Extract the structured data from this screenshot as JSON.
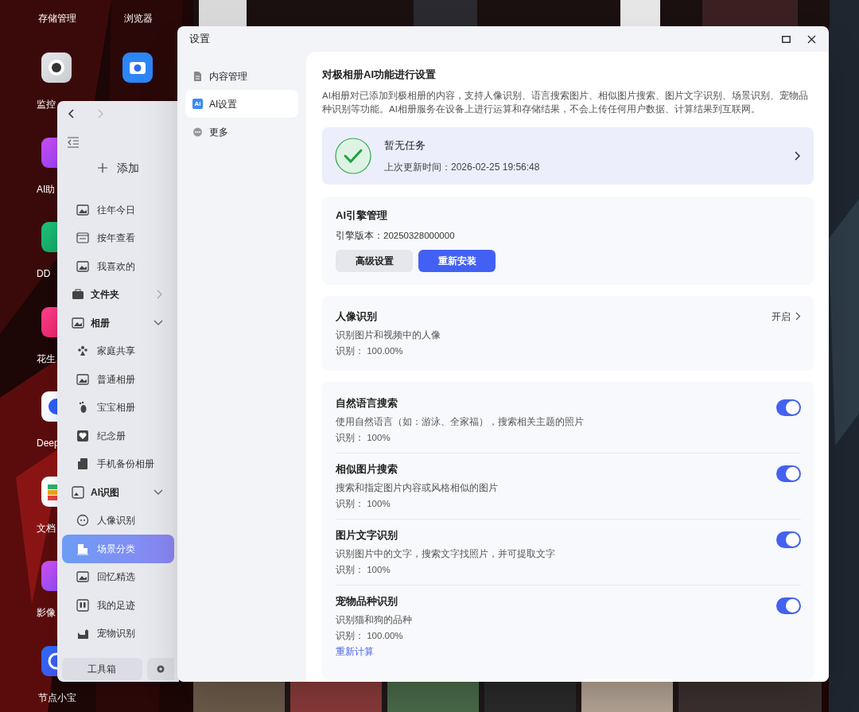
{
  "desktop": {
    "top_labels": [
      "存储管理",
      "浏览器"
    ],
    "apps": [
      {
        "label": "监控"
      },
      {
        "label": "AI助"
      },
      {
        "label": "DD"
      },
      {
        "label": "花生"
      },
      {
        "label": "Deep"
      },
      {
        "label": "文档"
      },
      {
        "label": "影像"
      },
      {
        "label": "节点小宝"
      }
    ]
  },
  "photo_app": {
    "add_button": "添加",
    "sidebar": [
      {
        "kind": "item",
        "label": "往年今日"
      },
      {
        "kind": "item",
        "label": "按年查看"
      },
      {
        "kind": "item",
        "label": "我喜欢的"
      },
      {
        "kind": "group",
        "label": "文件夹",
        "expanded": false
      },
      {
        "kind": "group",
        "label": "相册",
        "expanded": true,
        "children": [
          {
            "label": "家庭共享",
            "selected": false
          },
          {
            "label": "普通相册",
            "selected": false
          },
          {
            "label": "宝宝相册",
            "selected": false
          },
          {
            "label": "纪念册",
            "selected": false
          },
          {
            "label": "手机备份相册",
            "selected": false
          }
        ]
      },
      {
        "kind": "group",
        "label": "AI识图",
        "expanded": true,
        "children": [
          {
            "label": "人像识别",
            "selected": false
          },
          {
            "label": "场景分类",
            "selected": true
          },
          {
            "label": "回忆精选",
            "selected": false
          },
          {
            "label": "我的足迹",
            "selected": false
          },
          {
            "label": "宠物识别",
            "selected": false
          }
        ]
      }
    ],
    "toolbox_button": "工具箱"
  },
  "settings": {
    "window": {
      "title": "设置"
    },
    "tabs": [
      {
        "label": "内容管理",
        "selected": false
      },
      {
        "label": "AI设置",
        "selected": true,
        "badge": "Ai"
      },
      {
        "label": "更多",
        "selected": false
      }
    ],
    "heading": "对极相册AI功能进行设置",
    "description": "AI相册对已添加到极相册的内容，支持人像识别、语言搜索图片、相似图片搜索、图片文字识别、场景识别、宠物品种识别等功能。AI相册服务在设备上进行运算和存储结果，不会上传任何用户数据、计算结果到互联网。",
    "task": {
      "title": "暂无任务",
      "updated": "上次更新时间：2026-02-25 19:56:48"
    },
    "engine": {
      "title": "AI引擎管理",
      "version": "引擎版本：20250328000000",
      "buttons": [
        {
          "label": "高级设置",
          "kind": "secondary"
        },
        {
          "label": "重新安装",
          "kind": "primary"
        }
      ]
    },
    "face": {
      "title": "人像识别",
      "description": "识别图片和视频中的人像",
      "reading": "识别：  100.00%",
      "action": "开启"
    },
    "features": [
      {
        "title": "自然语言搜索",
        "description": "使用自然语言（如：游泳、全家福），搜索相关主题的照片",
        "reading": "识别：  100%",
        "on": true
      },
      {
        "title": "相似图片搜索",
        "description": "搜索和指定图片内容或风格相似的图片",
        "reading": "识别：  100%",
        "on": true
      },
      {
        "title": "图片文字识别",
        "description": "识别图片中的文字，搜索文字找照片，并可提取文字",
        "reading": "识别：  100%",
        "on": true
      },
      {
        "title": "宠物品种识别",
        "description": "识别猫和狗的品种",
        "reading": "识别：  100.00%",
        "on": true,
        "link": "重新计算"
      }
    ]
  }
}
